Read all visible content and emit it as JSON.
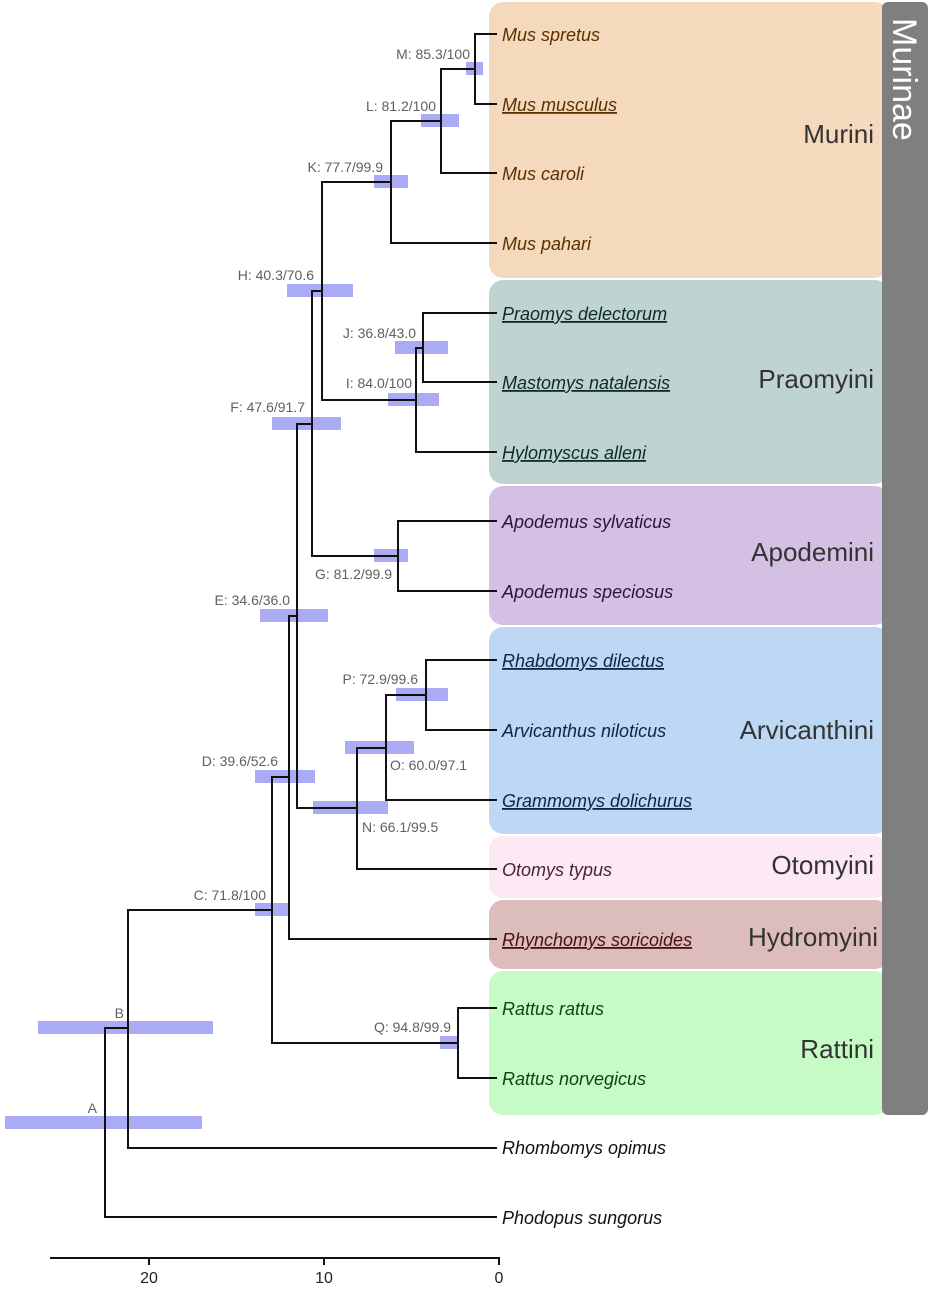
{
  "superfamily_label": "Murinae",
  "colors": {
    "murini": "#f5d9bc",
    "praomyini": "#bfd3d0",
    "apodemini": "#d3c0e3",
    "arvicanthini": "#bdd8f4",
    "otomyini": "#fce9f4",
    "hydromyini": "#ddbcbc",
    "rattini": "#c7fbc6",
    "murinae_bar": "#7f7f7f",
    "hpd_bar": "#aaaaf5",
    "branch": "#111111"
  },
  "tribes": [
    {
      "id": "murini",
      "label": "Murini",
      "text_color": "#5a3000"
    },
    {
      "id": "praomyini",
      "label": "Praomyini",
      "text_color": "#0d2b2b"
    },
    {
      "id": "apodemini",
      "label": "Apodemini",
      "text_color": "#2a1540"
    },
    {
      "id": "arvicanthini",
      "label": "Arvicanthini",
      "text_color": "#0b2545"
    },
    {
      "id": "otomyini",
      "label": "Otomyini",
      "text_color": "#4a1f3a"
    },
    {
      "id": "hydromyini",
      "label": "Hydromyini",
      "text_color": "#4a1010"
    },
    {
      "id": "rattini",
      "label": "Rattini",
      "text_color": "#0f4510"
    }
  ],
  "taxa": [
    {
      "id": "t1",
      "name": "Mus spretus",
      "underline": false
    },
    {
      "id": "t2",
      "name": "Mus musculus",
      "underline": true
    },
    {
      "id": "t3",
      "name": "Mus caroli",
      "underline": false
    },
    {
      "id": "t4",
      "name": "Mus pahari",
      "underline": false
    },
    {
      "id": "t5",
      "name": "Praomys delectorum",
      "underline": true
    },
    {
      "id": "t6",
      "name": "Mastomys natalensis",
      "underline": true
    },
    {
      "id": "t7",
      "name": "Hylomyscus alleni",
      "underline": true
    },
    {
      "id": "t8",
      "name": "Apodemus sylvaticus",
      "underline": false
    },
    {
      "id": "t9",
      "name": "Apodemus speciosus",
      "underline": false
    },
    {
      "id": "t10",
      "name": "Rhabdomys dilectus",
      "underline": true
    },
    {
      "id": "t11",
      "name": "Arvicanthus niloticus",
      "underline": false
    },
    {
      "id": "t12",
      "name": "Grammomys dolichurus",
      "underline": true
    },
    {
      "id": "t13",
      "name": "Otomys typus",
      "underline": false
    },
    {
      "id": "t14",
      "name": "Rhynchomys soricoides",
      "underline": true
    },
    {
      "id": "t15",
      "name": "Rattus rattus",
      "underline": false
    },
    {
      "id": "t16",
      "name": "Rattus norvegicus",
      "underline": false
    },
    {
      "id": "t17",
      "name": "Rhombomys opimus",
      "underline": false
    },
    {
      "id": "t18",
      "name": "Phodopus sungorus",
      "underline": false
    }
  ],
  "nodes": [
    {
      "id": "A",
      "label": "A",
      "age": 22.9,
      "hpd": [
        28.1,
        17.1
      ]
    },
    {
      "id": "B",
      "label": "B",
      "age": 21.4,
      "hpd": [
        26.4,
        16.4
      ]
    },
    {
      "id": "C",
      "label": "C: 71.8/100",
      "age": 13.0,
      "hpd": [
        13.9,
        12.1
      ]
    },
    {
      "id": "D",
      "label": "D: 39.6/52.6",
      "age": 12.3,
      "hpd": [
        14.0,
        10.6
      ]
    },
    {
      "id": "E",
      "label": "E: 34.6/36.0",
      "age": 11.7,
      "hpd": [
        13.7,
        9.8
      ]
    },
    {
      "id": "F",
      "label": "F: 47.6/91.7",
      "age": 11.0,
      "hpd": [
        12.9,
        9.0
      ]
    },
    {
      "id": "G",
      "label": "G: 81.2/99.9",
      "age": 5.8,
      "hpd": [
        7.0,
        5.1
      ]
    },
    {
      "id": "H",
      "label": "H: 40.3/70.6",
      "age": 10.3,
      "hpd": [
        12.0,
        8.3
      ]
    },
    {
      "id": "I",
      "label": "I: 84.0/100",
      "age": 4.8,
      "hpd": [
        6.3,
        3.4
      ]
    },
    {
      "id": "J",
      "label": "J: 36.8/43.0",
      "age": 4.3,
      "hpd": [
        5.9,
        2.9
      ]
    },
    {
      "id": "K",
      "label": "K: 77.7/99.9",
      "age": 6.2,
      "hpd": [
        7.1,
        5.2
      ]
    },
    {
      "id": "L",
      "label": "L: 81.2/100",
      "age": 3.3,
      "hpd": [
        4.4,
        2.3
      ]
    },
    {
      "id": "M",
      "label": "M: 85.3/100",
      "age": 1.4,
      "hpd": [
        1.9,
        0.9
      ]
    },
    {
      "id": "N",
      "label": "N: 66.1/99.5",
      "age": 8.2,
      "hpd": [
        10.6,
        6.3
      ]
    },
    {
      "id": "O",
      "label": "O: 60.0/97.1",
      "age": 6.6,
      "hpd": [
        8.8,
        4.8
      ]
    },
    {
      "id": "P",
      "label": "P: 72.9/99.6",
      "age": 4.2,
      "hpd": [
        5.8,
        2.9
      ]
    },
    {
      "id": "Q",
      "label": "Q: 94.8/99.9",
      "age": 2.3,
      "hpd": [
        3.3,
        2.1
      ]
    }
  ],
  "axis": {
    "ticks": [
      20,
      10,
      0
    ],
    "range": [
      26,
      0
    ]
  }
}
